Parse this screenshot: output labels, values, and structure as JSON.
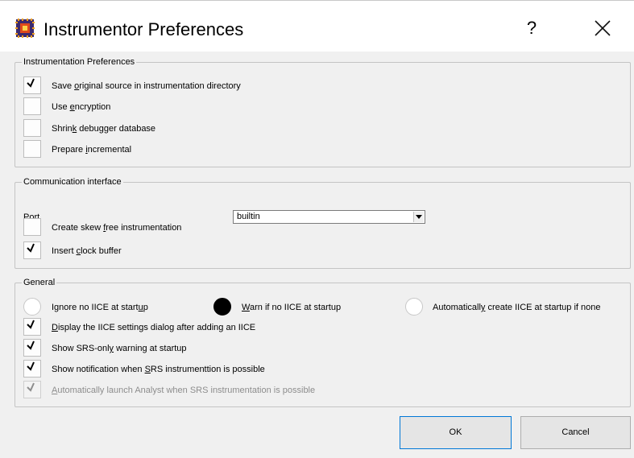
{
  "window": {
    "title": "Instrumentor Preferences",
    "help_label": "?",
    "app_icon": "chip-icon",
    "close_icon": "close-icon"
  },
  "instrumentation": {
    "legend": "Instrumentation Preferences",
    "items": [
      {
        "label": "Save original source in instrumentation directory",
        "checked": true
      },
      {
        "label": "Use encryption",
        "checked": false
      },
      {
        "label": "Shrink debugger database",
        "checked": false
      },
      {
        "label": "Prepare incremental",
        "checked": false
      }
    ]
  },
  "communication": {
    "legend": "Communication interface",
    "port_label": "Port",
    "port_value": "builtin",
    "items": [
      {
        "label": "Create skew free instrumentation",
        "checked": false
      },
      {
        "label": "Insert clock buffer",
        "checked": true
      }
    ]
  },
  "general": {
    "legend": "General",
    "radios": [
      {
        "label": "Ignore no IICE at startup",
        "selected": false
      },
      {
        "label": "Warn if no IICE at startup",
        "selected": true
      },
      {
        "label": "Automatically create IICE at startup if none",
        "selected": false
      }
    ],
    "items": [
      {
        "label": "Display the IICE settings dialog after adding an IICE",
        "checked": true
      },
      {
        "label": "Show SRS-only warning at startup",
        "checked": true
      },
      {
        "label": "Show notification when SRS instrumenttion is possible",
        "checked": true
      },
      {
        "label": "Automatically launch Analyst when SRS instrumentation is possible",
        "checked": true,
        "disabled": true
      }
    ]
  },
  "buttons": {
    "ok": "OK",
    "cancel": "Cancel"
  },
  "colors": {
    "background": "#f0f0f0",
    "titlebar": "#ffffff",
    "default_button_border": "#0078d7"
  }
}
